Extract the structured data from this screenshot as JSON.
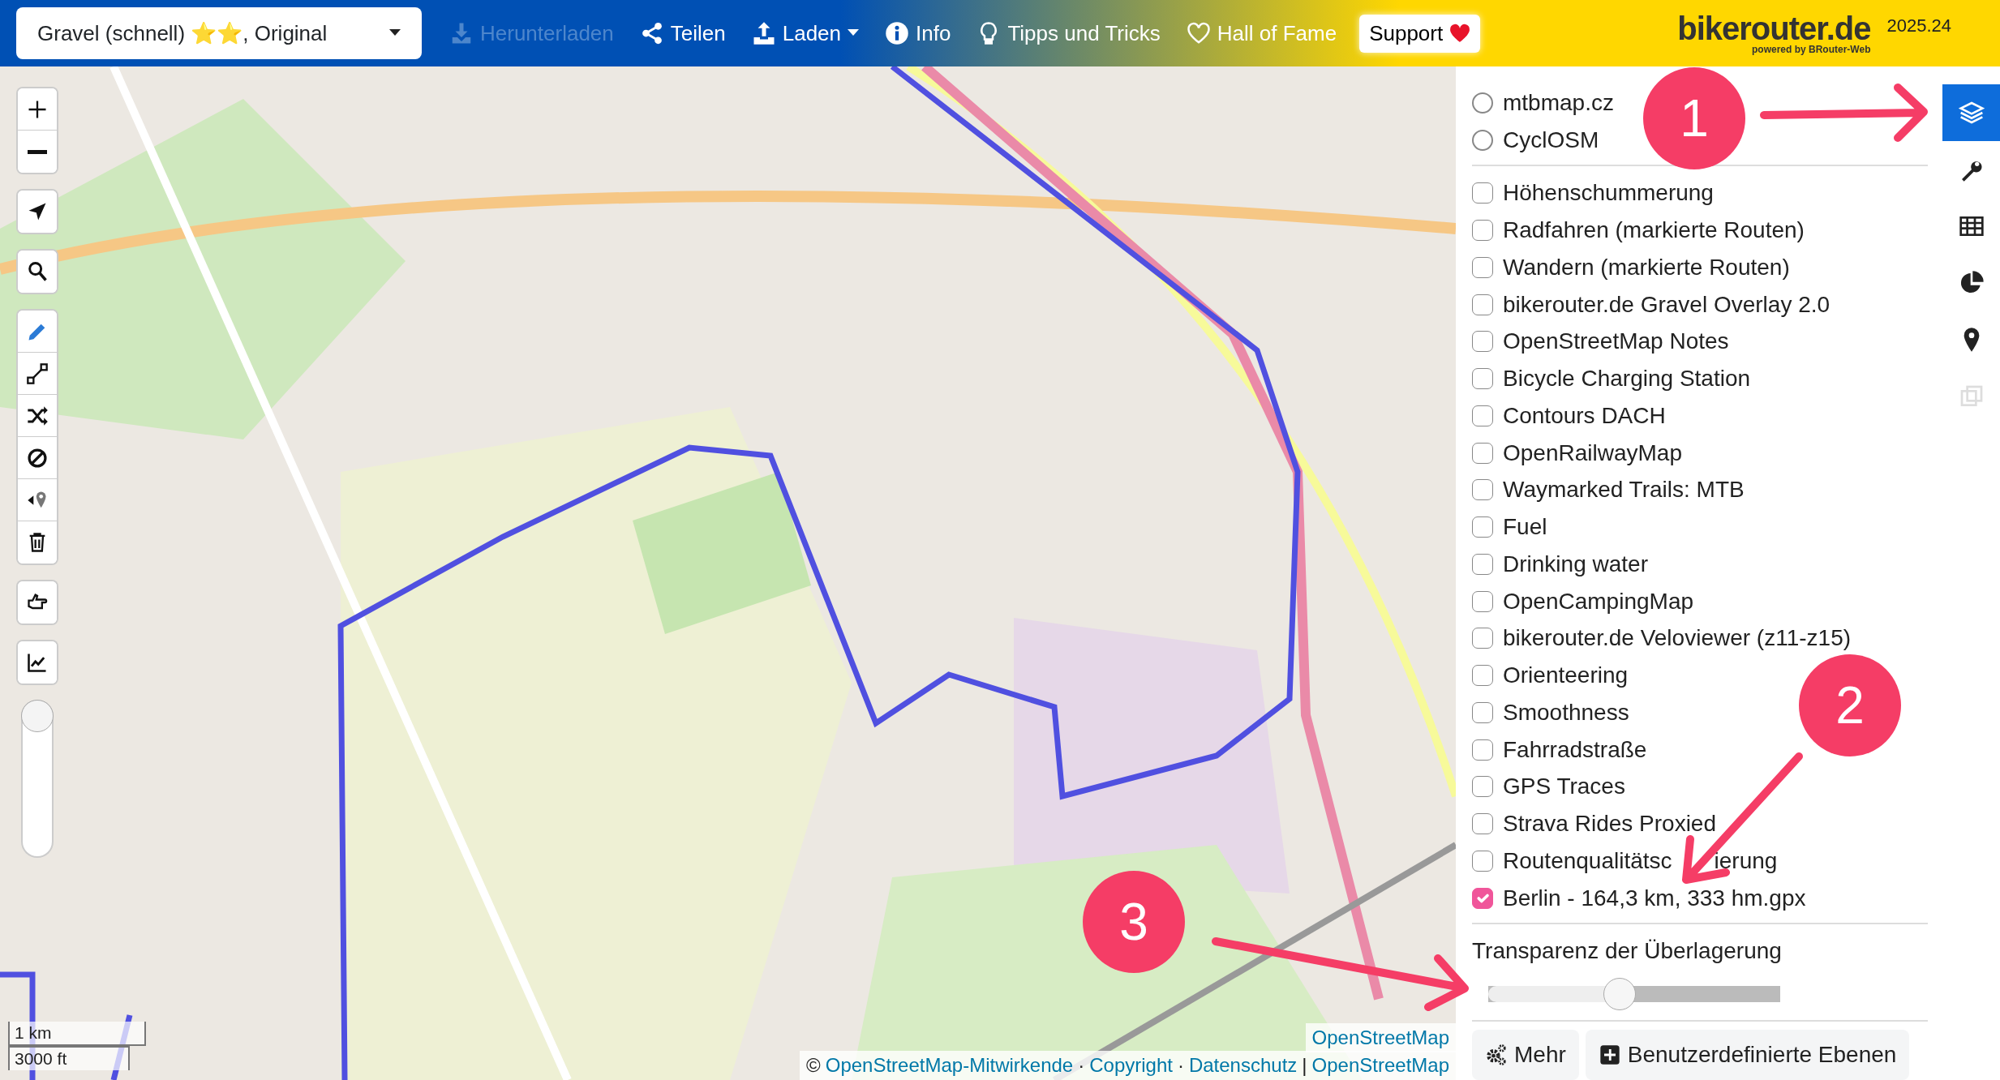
{
  "navbar": {
    "profile": {
      "name": "Gravel (schnell) ⭐⭐, Original"
    },
    "items": [
      {
        "kind": "download",
        "label": "Herunterladen",
        "disabled": true,
        "dropdown": false
      },
      {
        "kind": "share",
        "label": "Teilen",
        "disabled": false,
        "dropdown": false
      },
      {
        "kind": "upload",
        "label": "Laden",
        "disabled": false,
        "dropdown": true
      },
      {
        "kind": "info",
        "label": "Info",
        "disabled": false,
        "dropdown": false
      },
      {
        "kind": "bulb",
        "label": "Tipps und Tricks",
        "disabled": false,
        "dropdown": false
      },
      {
        "kind": "heart",
        "label": "Hall of Fame",
        "disabled": false,
        "dropdown": false
      }
    ],
    "support": {
      "label": "Support"
    },
    "logo": {
      "title": "bikerouter.de",
      "subtitle": "powered by BRouter-Web",
      "version": "2025.24"
    }
  },
  "map": {
    "control_groups": [
      {
        "buttons": [
          {
            "kind": "plus"
          },
          {
            "kind": "minus"
          }
        ]
      },
      {
        "buttons": [
          {
            "kind": "locate"
          }
        ]
      },
      {
        "buttons": [
          {
            "kind": "search"
          }
        ]
      },
      {
        "buttons": [
          {
            "kind": "pencil",
            "selected": true
          },
          {
            "kind": "route",
            "selected": false
          },
          {
            "kind": "shuffle",
            "selected": false
          },
          {
            "kind": "ban",
            "selected": false
          },
          {
            "kind": "pin",
            "selected": false
          },
          {
            "kind": "trash",
            "selected": false
          }
        ]
      },
      {
        "buttons": [
          {
            "kind": "hand"
          }
        ]
      },
      {
        "buttons": [
          {
            "kind": "chart"
          }
        ]
      }
    ],
    "zoom_slider": {
      "level": 1
    },
    "scale": [
      "1 km",
      "3000 ft"
    ],
    "attribution_top": "OpenStreetMap",
    "attribution": [
      {
        "kind": "text",
        "text": "©"
      },
      {
        "kind": "link",
        "text": "OpenStreetMap-Mitwirkende"
      },
      {
        "kind": "text",
        "text": "·"
      },
      {
        "kind": "link",
        "text": "Copyright"
      },
      {
        "kind": "text",
        "text": "·"
      },
      {
        "kind": "link",
        "text": "Datenschutz"
      },
      {
        "kind": "text",
        "text": "|"
      },
      {
        "kind": "link",
        "text": "OpenStreetMap"
      }
    ]
  },
  "layers_panel": {
    "base_layers": [
      {
        "label": "mtbmap.cz",
        "selected": false
      },
      {
        "label": "CyclOSM",
        "selected": false
      }
    ],
    "overlays": [
      {
        "label": "Höhenschummerung",
        "checked": false
      },
      {
        "label": "Radfahren (markierte Routen)",
        "checked": false
      },
      {
        "label": "Wandern (markierte Routen)",
        "checked": false
      },
      {
        "label": "bikerouter.de Gravel Overlay 2.0",
        "checked": false
      },
      {
        "label": "OpenStreetMap Notes",
        "checked": false
      },
      {
        "label": "Bicycle Charging Station",
        "checked": false
      },
      {
        "label": "Contours DACH",
        "checked": false
      },
      {
        "label": "OpenRailwayMap",
        "checked": false
      },
      {
        "label": "Waymarked Trails: MTB",
        "checked": false
      },
      {
        "label": "Fuel",
        "checked": false
      },
      {
        "label": "Drinking water",
        "checked": false
      },
      {
        "label": "OpenCampingMap",
        "checked": false
      },
      {
        "label": "bikerouter.de Veloviewer (z11-z15)",
        "checked": false
      },
      {
        "label": "Orienteering",
        "checked": false
      },
      {
        "label": "Smoothness",
        "checked": false
      },
      {
        "label": "Fahrradstraße",
        "checked": false
      },
      {
        "label": "GPS Traces",
        "checked": false
      },
      {
        "label": "Strava Rides Proxied",
        "checked": false
      },
      {
        "label": "Routenqualitätsc",
        "label_end": "ierung",
        "checked": false
      },
      {
        "label": "Berlin - 164,3 km, 333 hm.gpx",
        "checked": true
      }
    ],
    "opacity": {
      "label": "Transparenz der Überlagerung",
      "level": 0.45
    },
    "buttons": [
      {
        "kind": "gears",
        "label": "Mehr"
      },
      {
        "kind": "plus",
        "label": "Benutzerdefinierte Ebenen"
      }
    ]
  },
  "sidebar_tabs": [
    {
      "kind": "layers",
      "selected": true,
      "disabled": false
    },
    {
      "kind": "wrench",
      "selected": false,
      "disabled": false
    },
    {
      "kind": "table",
      "selected": false,
      "disabled": false
    },
    {
      "kind": "pie",
      "selected": false,
      "disabled": false
    },
    {
      "kind": "marker",
      "selected": false,
      "disabled": false
    },
    {
      "kind": "copy",
      "selected": false,
      "disabled": true
    }
  ],
  "annotations": [
    {
      "label": "1"
    },
    {
      "label": "2"
    },
    {
      "label": "3"
    }
  ]
}
